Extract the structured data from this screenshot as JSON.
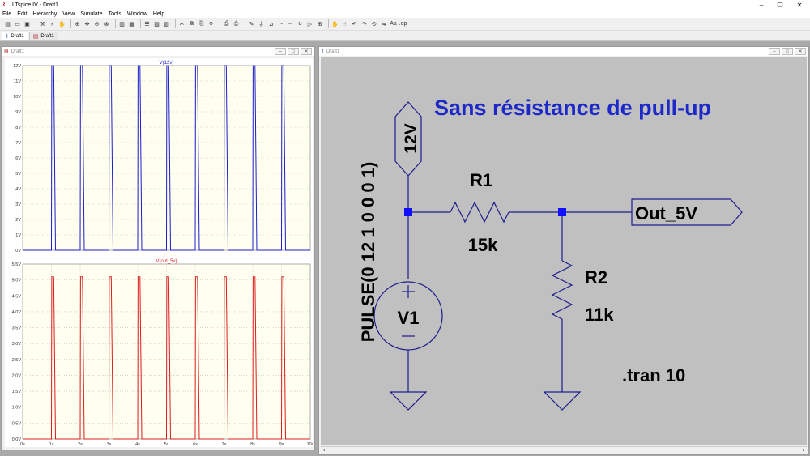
{
  "app": {
    "title": "LTspice IV - Draft1"
  },
  "menu": [
    "File",
    "Edit",
    "Hierarchy",
    "View",
    "Simulate",
    "Tools",
    "Window",
    "Help"
  ],
  "tabs": [
    {
      "label": "Draft1"
    },
    {
      "label": "Draft1"
    }
  ],
  "waveform_window": {
    "title": "Draft1"
  },
  "schematic_window": {
    "title": "Draft1"
  },
  "chart_data": [
    {
      "type": "line",
      "title": "V(12v)",
      "ylabel": "",
      "xlabel": "",
      "y_ticks": [
        "0V",
        "1V",
        "2V",
        "3V",
        "4V",
        "5V",
        "6V",
        "7V",
        "8V",
        "9V",
        "10V",
        "11V",
        "12V"
      ],
      "x_ticks": [
        "0s",
        "1s",
        "2s",
        "3s",
        "4s",
        "5s",
        "6s",
        "7s",
        "8s",
        "9s",
        "10s"
      ],
      "ylim": [
        0,
        12
      ],
      "xlim": [
        0,
        10
      ],
      "grid": true,
      "color": "#1c1ccc",
      "pulse_starts": [
        1.0,
        2.0,
        3.0,
        4.0,
        5.0,
        6.0,
        7.0,
        8.0,
        9.0
      ],
      "pulse_width": 0.08,
      "pulse_high": 12
    },
    {
      "type": "line",
      "title": "V(out_5v)",
      "ylabel": "",
      "xlabel": "",
      "y_ticks": [
        "0.0V",
        "0.5V",
        "1.0V",
        "1.5V",
        "2.0V",
        "2.5V",
        "3.0V",
        "3.5V",
        "4.0V",
        "4.5V",
        "5.0V",
        "5.5V"
      ],
      "x_ticks": [
        "0s",
        "1s",
        "2s",
        "3s",
        "4s",
        "5s",
        "6s",
        "7s",
        "8s",
        "9s",
        "10s"
      ],
      "ylim": [
        0,
        5.5
      ],
      "xlim": [
        0,
        10
      ],
      "grid": true,
      "color": "#dd1c1c",
      "pulse_starts": [
        1.0,
        2.0,
        3.0,
        4.0,
        5.0,
        6.0,
        7.0,
        8.0,
        9.0
      ],
      "pulse_width": 0.08,
      "pulse_high": 5.1
    }
  ],
  "schematic": {
    "heading": "Sans résistance de pull-up",
    "source_value": "PULSE(0 12 1 0 0 0 1)",
    "source_name": "V1",
    "net_12v": "12V",
    "net_out": "Out_5V",
    "r1_name": "R1",
    "r1_value": "15k",
    "r2_name": "R2",
    "r2_value": "11k",
    "directive": ".tran 10",
    "colors": {
      "wire": "#1c1c8c",
      "heading": "#1c28c8",
      "junction": "#1010ff"
    }
  }
}
